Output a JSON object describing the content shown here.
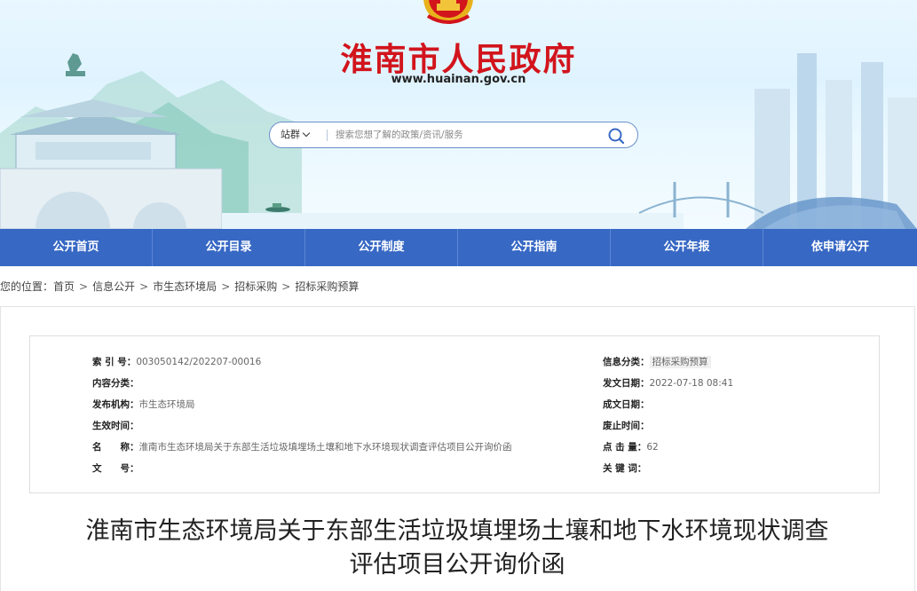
{
  "header": {
    "site_name": "淮南市人民政府",
    "site_url": "www.huainan.gov.cn"
  },
  "search": {
    "scope_label": "站群",
    "placeholder": "搜索您想了解的政策/资讯/服务"
  },
  "nav": {
    "items": [
      "公开首页",
      "公开目录",
      "公开制度",
      "公开指南",
      "公开年报",
      "依申请公开"
    ]
  },
  "breadcrumb": {
    "prefix": "您的位置：",
    "items": [
      "首页",
      "信息公开",
      "市生态环境局",
      "招标采购",
      "招标采购预算"
    ],
    "separator": ">"
  },
  "meta": {
    "index_no": {
      "label": "索 引 号：",
      "value": "003050142/202207-00016"
    },
    "content_category": {
      "label": "内容分类：",
      "value": ""
    },
    "publisher": {
      "label": "发布机构：",
      "value": "市生态环境局"
    },
    "effective_time": {
      "label": "生效时间：",
      "value": ""
    },
    "name": {
      "label": "名　　称：",
      "value": "淮南市生态环境局关于东部生活垃圾填埋场土壤和地下水环境现状调查评估项目公开询价函"
    },
    "doc_no": {
      "label": "文　　号：",
      "value": ""
    },
    "info_category": {
      "label": "信息分类：",
      "value": "招标采购预算"
    },
    "publish_date": {
      "label": "发文日期：",
      "value": "2022-07-18 08:41"
    },
    "created_date": {
      "label": "成文日期：",
      "value": ""
    },
    "expiry_time": {
      "label": "废止时间：",
      "value": ""
    },
    "hits": {
      "label": "点 击 量：",
      "value": "62"
    },
    "keywords": {
      "label": "关 键 词：",
      "value": ""
    }
  },
  "article": {
    "title_line1": "淮南市生态环境局关于东部生活垃圾填埋场土壤和地下水环境现状调查",
    "title_line2": "评估项目公开询价函"
  },
  "colors": {
    "brand_red": "#d2141c",
    "nav_blue": "#3768c4"
  }
}
